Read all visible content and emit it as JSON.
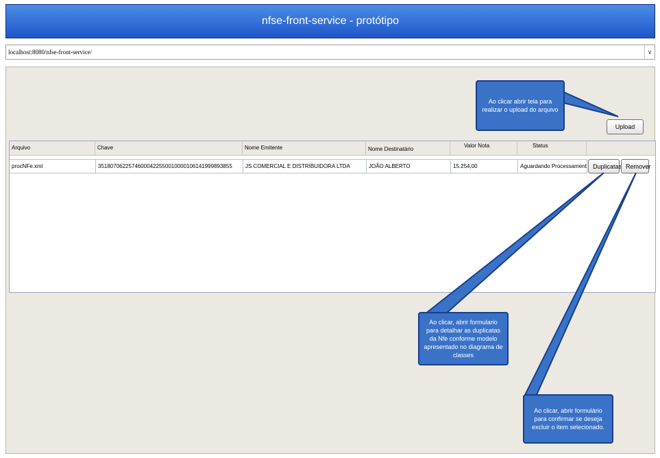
{
  "app": {
    "title": "nfse-front-service - protótipo"
  },
  "address_bar": {
    "url": "localhost:8080/nfse-front-service/"
  },
  "toolbar": {
    "upload_label": "Upload"
  },
  "table": {
    "headers": [
      "Arquivo",
      "Chave",
      "Nome Emitente",
      "Nome Destinatário",
      "Valor Nota",
      "Status"
    ],
    "rows": [
      {
        "arquivo": "procNFe.xml",
        "chave": "35180706225746000422550010000106141999893855",
        "nome_emitente": "JS COMERCIAL E DISTRIBUIDORA LTDA",
        "nome_destinatario": "JOÃO ALBERTO",
        "valor_nota": "15.254,00",
        "status": "Aguardando Processamento",
        "duplicatas_label": "Duplicatas",
        "remover_label": "Remover"
      }
    ]
  },
  "callouts": {
    "upload": "Ao clicar abrir tela para realizar o upload do arquivo",
    "duplicatas": "Ao clicar, abrir formulario para detalhar as duplicatas da Nfe conforme modelo apresentado no diagrama de classes",
    "remover": "Ao clicar, abrir formulário para confirmar se deseja excluir o item selecionado."
  },
  "colors": {
    "titlebar": "#2f6fd8",
    "callout": "#3a72c8",
    "panel": "#ece9e3"
  }
}
